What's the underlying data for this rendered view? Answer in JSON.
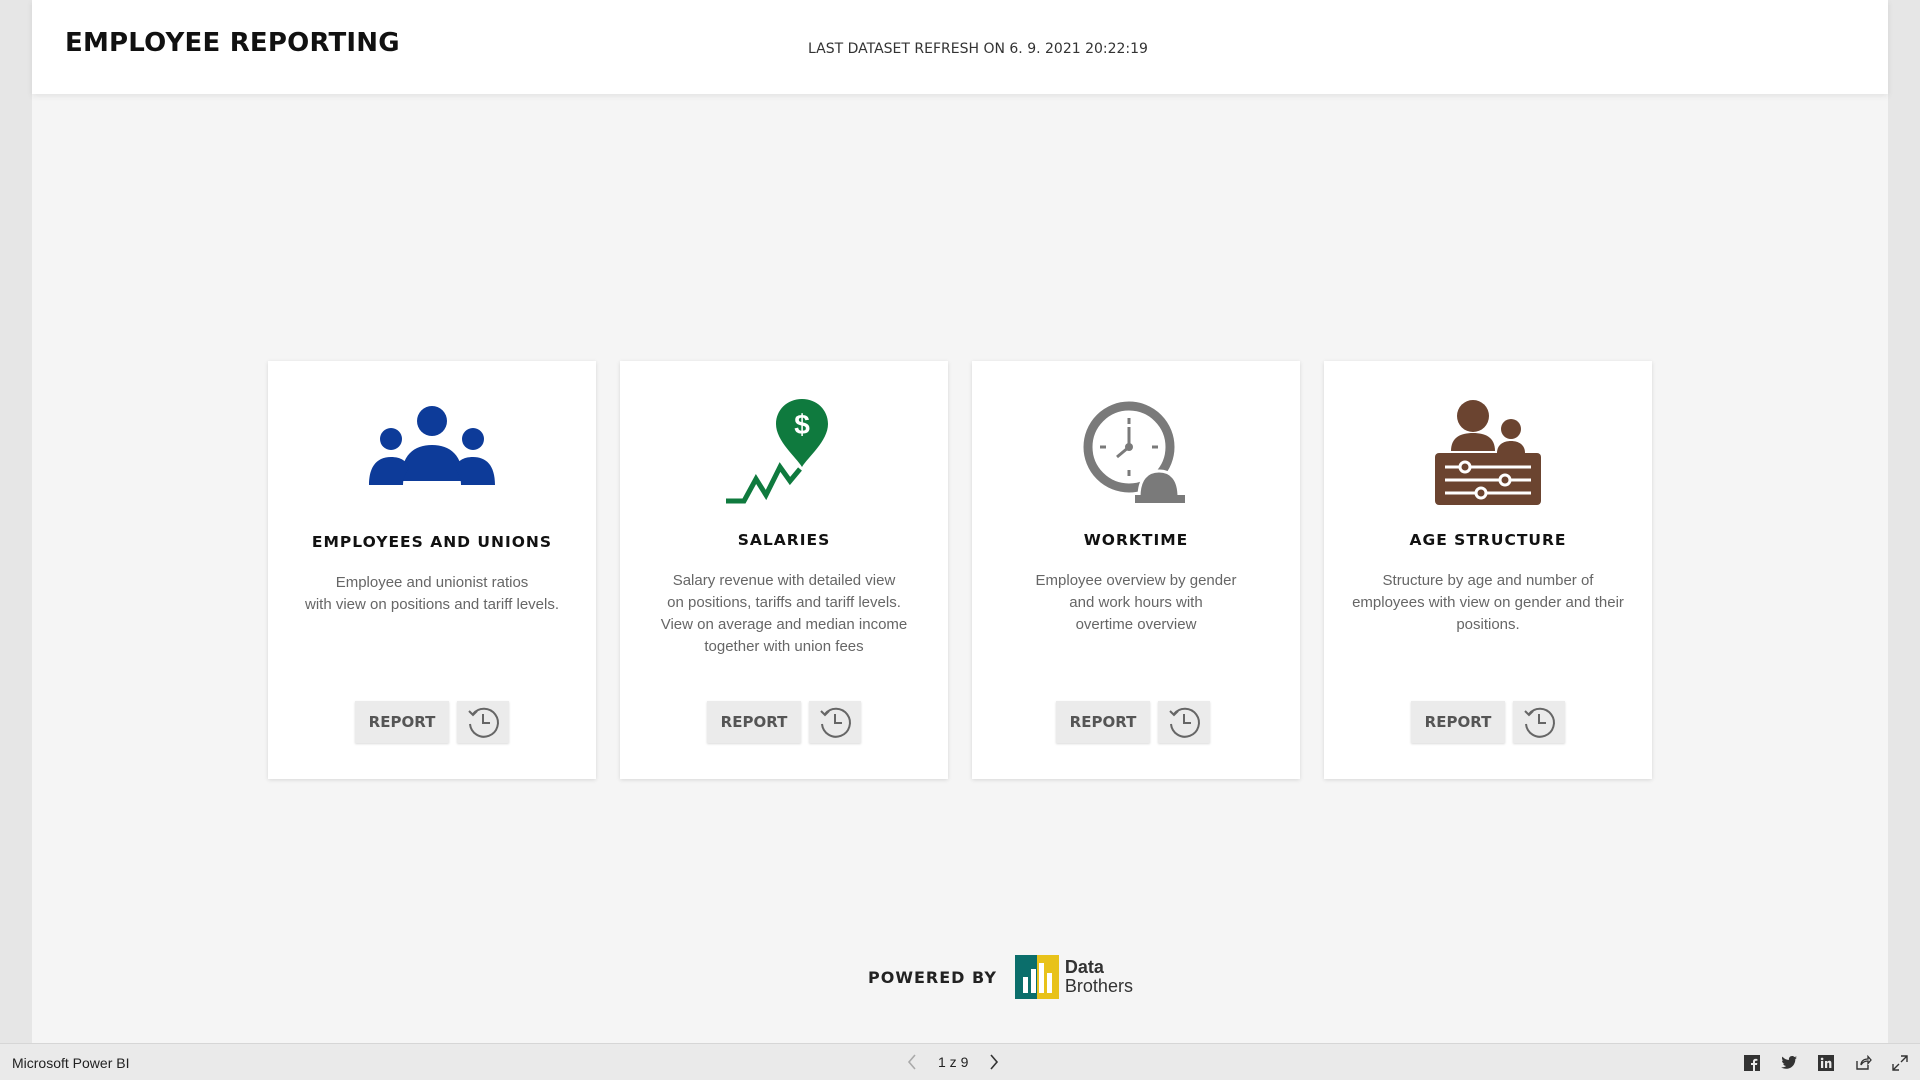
{
  "header": {
    "title": "EMPLOYEE REPORTING",
    "refresh_text": "LAST DATASET REFRESH ON 6. 9. 2021 20:22:19"
  },
  "cards": [
    {
      "title": "EMPLOYEES AND UNIONS",
      "description": "Employee and unionist ratios\nwith view on positions and tariff levels.",
      "report_label": "REPORT",
      "icon": "group-people-icon",
      "icon_color": "#0d3b99"
    },
    {
      "title": "SALARIES",
      "description": "Salary revenue with detailed view\non positions, tariffs and tariff levels.\nView on average and median income\ntogether with union fees",
      "report_label": "REPORT",
      "icon": "dollar-pin-growth-icon",
      "icon_color": "#0f7a3e"
    },
    {
      "title": "WORKTIME",
      "description": "Employee overview by gender\nand work hours with\novertime overview",
      "report_label": "REPORT",
      "icon": "clock-worker-icon",
      "icon_color": "#7a7a7a"
    },
    {
      "title": "AGE STRUCTURE",
      "description": "Structure by age and number of\nemployees with view on gender and their\npositions.",
      "report_label": "REPORT",
      "icon": "people-sliders-icon",
      "icon_color": "#6b4430"
    }
  ],
  "branding": {
    "powered_by": "POWERED BY",
    "logo_line1": "Data",
    "logo_line2": "Brothers"
  },
  "footer": {
    "app_name": "Microsoft Power BI",
    "page_indicator": "1 z 9",
    "share_icons": [
      "facebook-icon",
      "twitter-icon",
      "linkedin-icon",
      "share-icon",
      "fullscreen-icon"
    ]
  }
}
